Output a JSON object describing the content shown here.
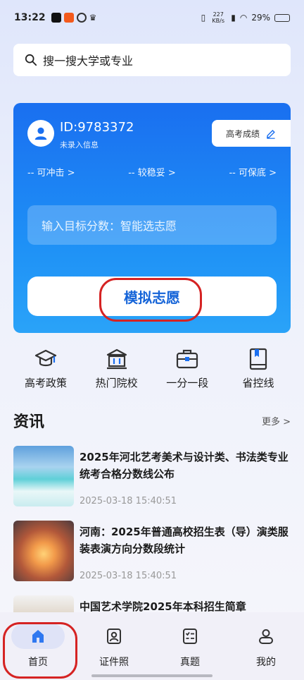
{
  "status_bar": {
    "time": "13:22",
    "network_speed": "227 KB/s",
    "battery": "29%"
  },
  "search": {
    "placeholder": "搜一搜大学或专业"
  },
  "card": {
    "user_id": "ID:9783372",
    "user_sub": "未录入信息",
    "score_button": "高考成绩",
    "tiers": [
      "-- 可冲击 >",
      "-- 较稳妥 >",
      "-- 可保底 >"
    ],
    "target_input_placeholder": "输入目标分数：智能选志愿",
    "simulate_button": "模拟志愿"
  },
  "quick_nav": [
    {
      "label": "高考政策",
      "icon": "graduation-cap-icon"
    },
    {
      "label": "热门院校",
      "icon": "institution-icon"
    },
    {
      "label": "一分一段",
      "icon": "briefcase-icon"
    },
    {
      "label": "省控线",
      "icon": "book-icon"
    }
  ],
  "news": {
    "title": "资讯",
    "more": "更多 >",
    "items": [
      {
        "text": "2025年河北艺考美术与设计类、书法类专业统考合格分数线公布",
        "time": "2025-03-18 15:40:51"
      },
      {
        "text": "河南：2025年普通高校招生表（导）演类服装表演方向分数段统计",
        "time": "2025-03-18 15:40:51"
      },
      {
        "text": "中国艺术学院2025年本科招生简章",
        "time": ""
      }
    ]
  },
  "bottom_nav": [
    {
      "label": "首页",
      "icon": "home-icon",
      "active": true
    },
    {
      "label": "证件照",
      "icon": "id-photo-icon",
      "active": false
    },
    {
      "label": "真题",
      "icon": "checklist-icon",
      "active": false
    },
    {
      "label": "我的",
      "icon": "profile-icon",
      "active": false
    }
  ],
  "colors": {
    "accent": "#1a6ff0",
    "highlight_circle": "#d52323"
  }
}
